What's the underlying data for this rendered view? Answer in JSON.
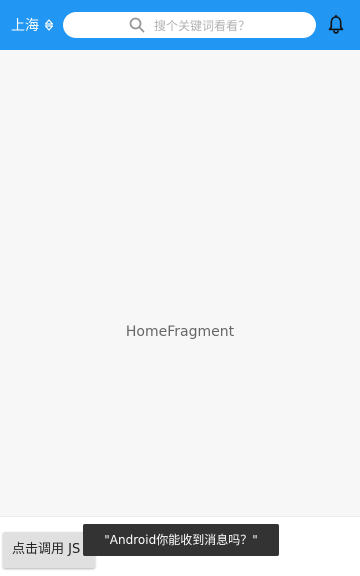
{
  "header": {
    "city": "上海",
    "search_placeholder": "搜个关键词看看？",
    "icons": {
      "city_caret": "caret-updown-icon",
      "search": "search-icon",
      "notification": "bell-icon"
    }
  },
  "main": {
    "fragment_label": "HomeFragment"
  },
  "bottom": {
    "call_js_button": "点击调用 JS"
  },
  "toast": {
    "message": "\"Android你能收到消息吗？\""
  },
  "colors": {
    "accent": "#2196f3",
    "background": "#f7f7f7",
    "toast_bg": "#333333"
  }
}
